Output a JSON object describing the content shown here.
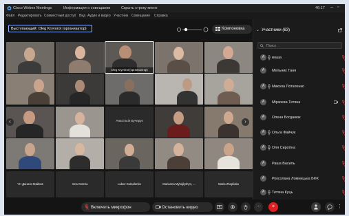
{
  "window": {
    "app_title": "Cisco Webex Meetings",
    "info_label": "Информация о совещании",
    "hide_menu_label": "Скрыть строку меню",
    "clock": "46:17"
  },
  "menu": [
    "Файл",
    "Редактировать",
    "Совместный доступ",
    "Вид",
    "Аудио и видео",
    "Участник",
    "Совещание",
    "Справка"
  ],
  "speaker": {
    "label": "Выступающий:",
    "name": "Oleg Kryvorot (организатор)"
  },
  "layout_button": "Компоновка",
  "tiles": [
    {
      "name": ""
    },
    {
      "name": ""
    },
    {
      "name": "Oleg Kryvorot (организатор)",
      "active": true
    },
    {
      "name": ""
    },
    {
      "name": ""
    },
    {
      "name": ""
    },
    {
      "name": ""
    },
    {
      "name": ""
    },
    {
      "name": ""
    },
    {
      "name": ""
    },
    {
      "name": ""
    },
    {
      "name": ""
    },
    {
      "name": "Анастасія Бучерук"
    },
    {
      "name": ""
    },
    {
      "name": ""
    },
    {
      "name": ""
    },
    {
      "name": ""
    },
    {
      "name": ""
    },
    {
      "name": ""
    },
    {
      "name": ""
    },
    {
      "name": "YH Данило Майков"
    },
    {
      "name": "Inna Gotcha"
    },
    {
      "name": "Lubov Gutsalenko"
    },
    {
      "name": "Marianna Myhajlyshyn, ..."
    },
    {
      "name": "Maria Zhepliaka"
    }
  ],
  "participants": {
    "title": "Участники (63)",
    "search_placeholder": "Поиск",
    "list": [
      {
        "name": "маша",
        "avatar": "A"
      },
      {
        "name": "Мельник Таня",
        "avatar": "A"
      },
      {
        "name": "Микола Потапенко",
        "avatar": "A"
      },
      {
        "name": "Мірзоєва Тетяна",
        "avatar": "A"
      },
      {
        "name": "Олена Богданюк",
        "avatar": "A"
      },
      {
        "name": "Ольга Файчук",
        "avatar": "A"
      },
      {
        "name": "Оля Сиротіна",
        "avatar": "A"
      },
      {
        "name": "Раша Василь",
        "avatar": "A"
      },
      {
        "name": "Роксолана Ломницька БФК",
        "avatar": "A"
      },
      {
        "name": "Тетяна Куць",
        "avatar": "A"
      }
    ]
  },
  "controls": {
    "mic_label": "Включить микрофон",
    "video_label": "Остановить видео",
    "end_icon": "×"
  },
  "colors": {
    "accent": "#8fb4ff",
    "muted_red": "#e23b3b",
    "end_red": "#e02020"
  }
}
